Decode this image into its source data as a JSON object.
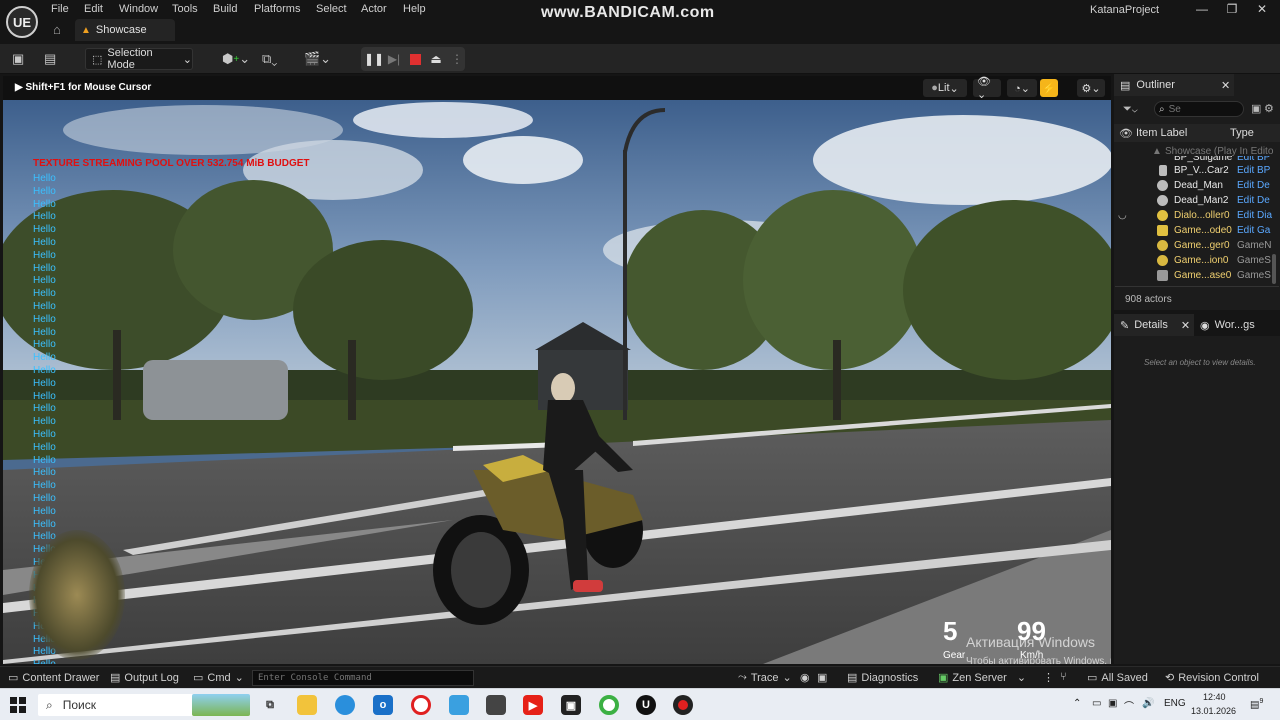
{
  "menubar": {
    "logo": "UE",
    "items": [
      "File",
      "Edit",
      "Window",
      "Tools",
      "Build",
      "Platforms",
      "Select",
      "Actor",
      "Help"
    ],
    "watermark": "www.BANDICAM.com",
    "project": "KatanaProject",
    "tab": "Showcase"
  },
  "toolbar": {
    "selection_mode": "Selection Mode"
  },
  "viewport": {
    "hint": "Shift+F1 for Mouse Cursor",
    "lit_label": "Lit",
    "texture_warning": "TEXTURE STREAMING POOL OVER 532.754 MiB BUDGET",
    "hello_text": "Hello",
    "gear_value": "5",
    "gear_label": "Gear",
    "speed_value": "99",
    "speed_label": "Km/h",
    "activation_title": "Активация Windows",
    "activation_text": "Чтобы активировать Windows, перейдите в раздел \"Параметры\"."
  },
  "outliner": {
    "title": "Outliner",
    "search_placeholder": "Se",
    "col_label": "Item Label",
    "col_type": "Type",
    "root": "Showcase (Play In Edito",
    "rows": [
      {
        "name": "BP_Sulgame",
        "type": "Edit BP"
      },
      {
        "name": "BP_V...Car2",
        "type": "Edit BP"
      },
      {
        "name": "Dead_Man",
        "type": "Edit De"
      },
      {
        "name": "Dead_Man2",
        "type": "Edit De"
      },
      {
        "name": "Dialo...oller0",
        "type": "Edit Dia"
      },
      {
        "name": "Game...ode0",
        "type": "Edit Ga"
      },
      {
        "name": "Game...ger0",
        "type": "GameN"
      },
      {
        "name": "Game...ion0",
        "type": "GameS"
      },
      {
        "name": "Game...ase0",
        "type": "GameS"
      }
    ],
    "actor_count": "908 actors"
  },
  "details": {
    "tab1": "Details",
    "tab2": "Wor...gs",
    "empty_text": "Select an object to view details."
  },
  "bottombar": {
    "content_drawer": "Content Drawer",
    "output_log": "Output Log",
    "cmd": "Cmd",
    "console_placeholder": "Enter Console Command",
    "trace": "Trace",
    "diagnostics": "Diagnostics",
    "zen_server": "Zen Server",
    "all_saved": "All Saved",
    "revision_control": "Revision Control"
  },
  "taskbar": {
    "search": "Поиск",
    "lang": "ENG",
    "time": "12:40",
    "date": "13.01.2026",
    "notifications": "9"
  }
}
